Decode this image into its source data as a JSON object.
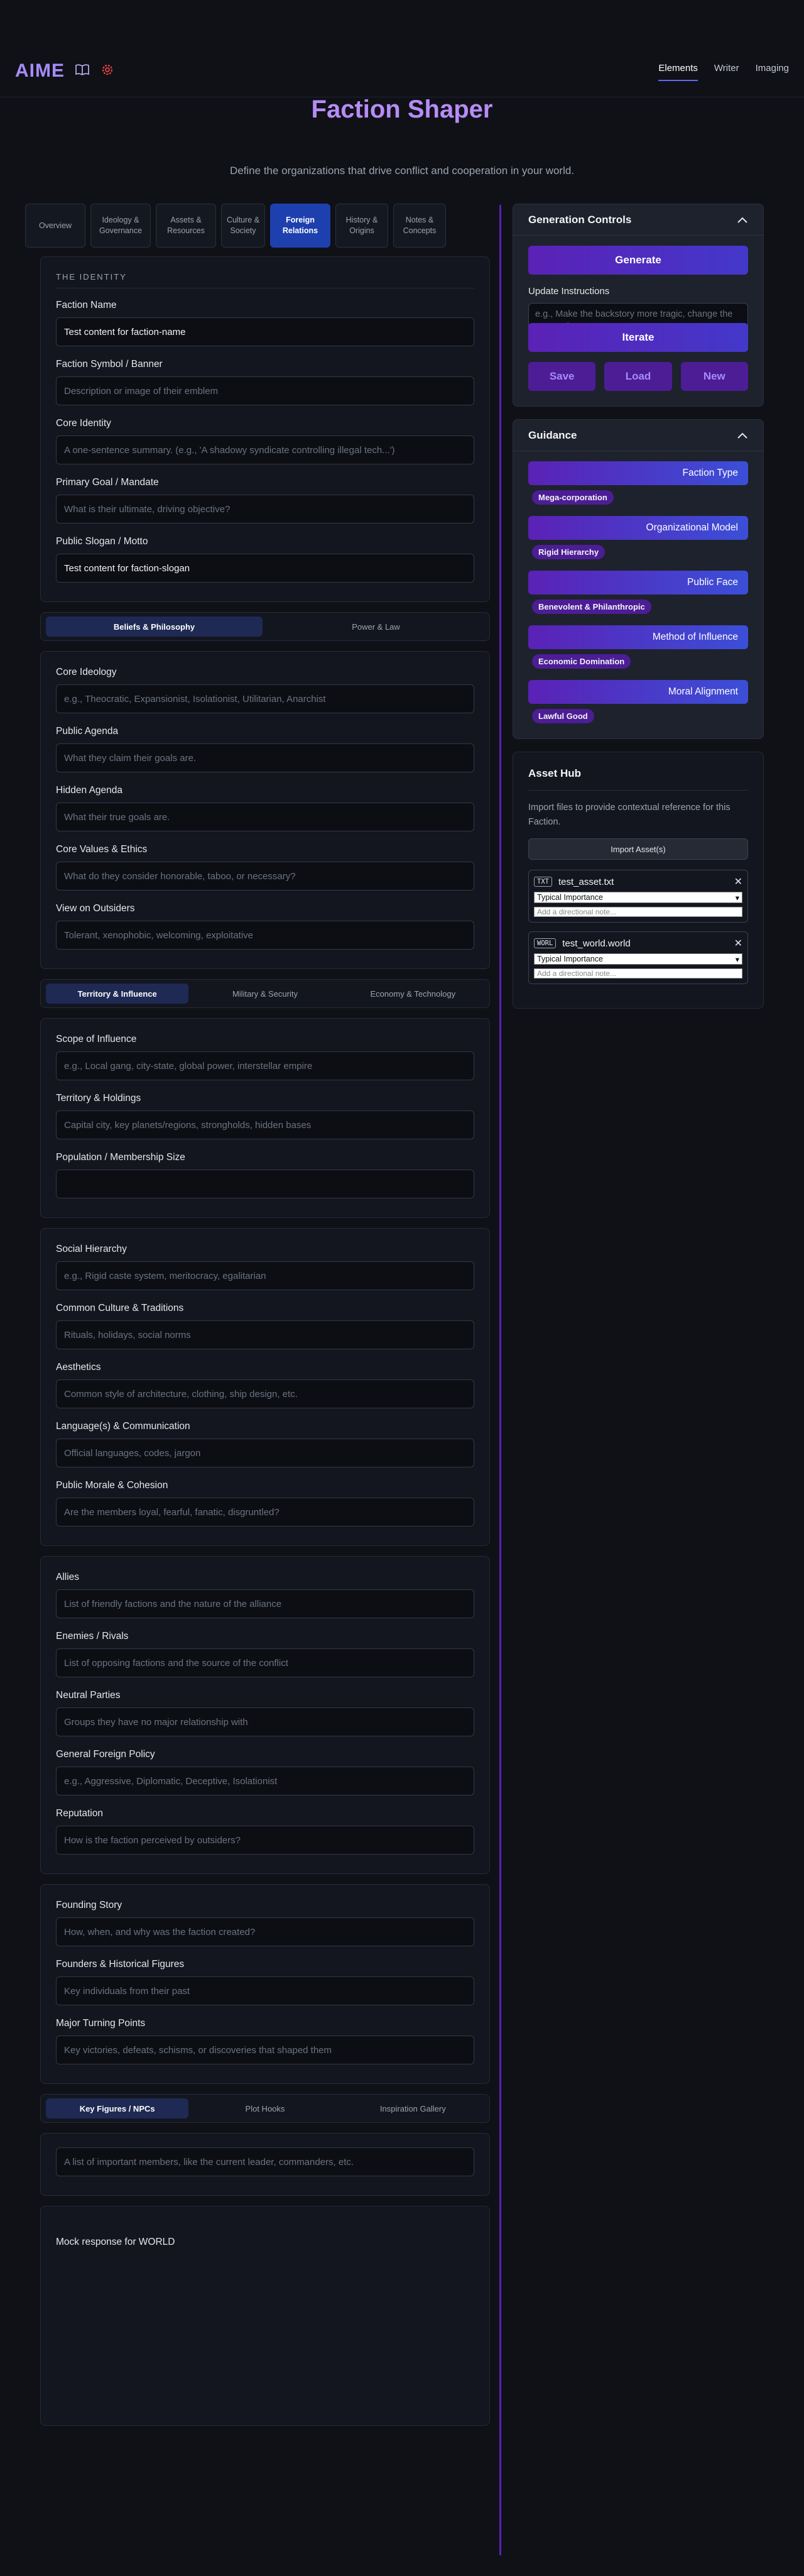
{
  "app": {
    "logo": "AIME"
  },
  "nav": {
    "items": [
      "Elements",
      "Writer",
      "Imaging"
    ],
    "active": "Elements"
  },
  "page": {
    "title": "Faction Shaper",
    "subtitle": "Define the organizations that drive conflict and cooperation in your world."
  },
  "main_tabs": [
    "Overview",
    "Ideology & Governance",
    "Assets & Resources",
    "Culture & Society",
    "Foreign Relations",
    "History & Origins",
    "Notes & Concepts"
  ],
  "active_tab": "Foreign Relations",
  "identity": {
    "section_label": "THE IDENTITY",
    "fields": [
      {
        "label": "Faction Name",
        "value": "Test content for faction-name",
        "placeholder": ""
      },
      {
        "label": "Faction Symbol / Banner",
        "value": "",
        "placeholder": "Description or image of their emblem"
      },
      {
        "label": "Core Identity",
        "value": "",
        "placeholder": "A one-sentence summary. (e.g., 'A shadowy syndicate controlling illegal tech...')"
      },
      {
        "label": "Primary Goal / Mandate",
        "value": "",
        "placeholder": "What is their ultimate, driving objective?"
      },
      {
        "label": "Public Slogan / Motto",
        "value": "Test content for faction-slogan",
        "placeholder": ""
      }
    ]
  },
  "subtabs1": {
    "items": [
      "Beliefs & Philosophy",
      "Power & Law"
    ],
    "active": 0
  },
  "beliefs": {
    "fields": [
      {
        "label": "Core Ideology",
        "placeholder": "e.g., Theocratic, Expansionist, Isolationist, Utilitarian, Anarchist"
      },
      {
        "label": "Public Agenda",
        "placeholder": "What they claim their goals are."
      },
      {
        "label": "Hidden Agenda",
        "placeholder": "What their true goals are."
      },
      {
        "label": "Core Values & Ethics",
        "placeholder": "What do they consider honorable, taboo, or necessary?"
      },
      {
        "label": "View on Outsiders",
        "placeholder": "Tolerant, xenophobic, welcoming, exploitative"
      }
    ]
  },
  "subtabs2": {
    "items": [
      "Territory & Influence",
      "Military & Security",
      "Economy & Technology"
    ],
    "active": 0
  },
  "territory": {
    "fields": [
      {
        "label": "Scope of Influence",
        "placeholder": "e.g., Local gang, city-state, global power, interstellar empire"
      },
      {
        "label": "Territory & Holdings",
        "placeholder": "Capital city, key planets/regions, strongholds, hidden bases"
      },
      {
        "label": "Population / Membership Size",
        "placeholder": ""
      }
    ]
  },
  "culture": {
    "fields": [
      {
        "label": "Social Hierarchy",
        "placeholder": "e.g., Rigid caste system, meritocracy, egalitarian"
      },
      {
        "label": "Common Culture & Traditions",
        "placeholder": "Rituals, holidays, social norms"
      },
      {
        "label": "Aesthetics",
        "placeholder": "Common style of architecture, clothing, ship design, etc."
      },
      {
        "label": "Language(s) & Communication",
        "placeholder": "Official languages, codes, jargon"
      },
      {
        "label": "Public Morale & Cohesion",
        "placeholder": "Are the members loyal, fearful, fanatic, disgruntled?"
      }
    ]
  },
  "relations": {
    "fields": [
      {
        "label": "Allies",
        "placeholder": "List of friendly factions and the nature of the alliance"
      },
      {
        "label": "Enemies / Rivals",
        "placeholder": "List of opposing factions and the source of the conflict"
      },
      {
        "label": "Neutral Parties",
        "placeholder": "Groups they have no major relationship with"
      },
      {
        "label": "General Foreign Policy",
        "placeholder": "e.g., Aggressive, Diplomatic, Deceptive, Isolationist"
      },
      {
        "label": "Reputation",
        "placeholder": "How is the faction perceived by outsiders?"
      }
    ]
  },
  "history": {
    "fields": [
      {
        "label": "Founding Story",
        "placeholder": "How, when, and why was the faction created?"
      },
      {
        "label": "Founders & Historical Figures",
        "placeholder": "Key individuals from their past"
      },
      {
        "label": "Major Turning Points",
        "placeholder": "Key victories, defeats, schisms, or discoveries that shaped them"
      }
    ]
  },
  "subtabs3": {
    "items": [
      "Key Figures / NPCs",
      "Plot Hooks",
      "Inspiration Gallery"
    ],
    "active": 0
  },
  "figures": {
    "placeholder": "A list of important members, like the current leader, commanders, etc."
  },
  "mock_response": "Mock response for WORLD",
  "generation": {
    "title": "Generation Controls",
    "generate": "Generate",
    "update_label": "Update Instructions",
    "update_placeholder": "e.g., Make the backstory more tragic, change the occupation to \"Sorcerer\"...",
    "iterate": "Iterate",
    "save": "Save",
    "load": "Load",
    "new": "New"
  },
  "guidance": {
    "title": "Guidance",
    "items": [
      {
        "button": "Faction Type",
        "value": "Mega-corporation"
      },
      {
        "button": "Organizational Model",
        "value": "Rigid Hierarchy"
      },
      {
        "button": "Public Face",
        "value": "Benevolent & Philanthropic"
      },
      {
        "button": "Method of Influence",
        "value": "Economic Domination"
      },
      {
        "button": "Moral Alignment",
        "value": "Lawful Good"
      }
    ]
  },
  "assets": {
    "title": "Asset Hub",
    "description": "Import files to provide contextual reference for this Faction.",
    "import": "Import Asset(s)",
    "items": [
      {
        "type": "TXT",
        "name": "test_asset.txt",
        "importance": "Typical Importance",
        "note_placeholder": "Add a directional note..."
      },
      {
        "type": "WORL",
        "name": "test_world.world",
        "importance": "Typical Importance",
        "note_placeholder": "Add a directional note..."
      }
    ]
  },
  "colors": {
    "accent": "#a78bfa",
    "primary": "#1e40af",
    "purple": "#5b21b6"
  }
}
